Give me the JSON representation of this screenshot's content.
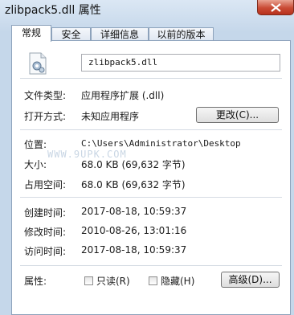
{
  "window": {
    "title": "zlibpack5.dll 属性"
  },
  "tabs": [
    {
      "label": "常规",
      "active": true
    },
    {
      "label": "安全",
      "active": false
    },
    {
      "label": "详细信息",
      "active": false
    },
    {
      "label": "以前的版本",
      "active": false
    }
  ],
  "general": {
    "file_name": "zlibpack5.dll",
    "type_label": "文件类型:",
    "type_value": "应用程序扩展 (.dll)",
    "opens_label": "打开方式:",
    "opens_value": "未知应用程序",
    "change_button": "更改(C)...",
    "location_label": "位置:",
    "location_value": "C:\\Users\\Administrator\\Desktop",
    "size_label": "大小:",
    "size_value": "68.0 KB (69,632 字节)",
    "disk_label": "占用空间:",
    "disk_value": "68.0 KB (69,632 字节)",
    "created_label": "创建时间:",
    "created_value": "2017-08-18, 10:59:37",
    "modified_label": "修改时间:",
    "modified_value": "2010-08-26, 13:01:16",
    "accessed_label": "访问时间:",
    "accessed_value": "2017-08-18, 10:59:37",
    "attributes_label": "属性:",
    "readonly_label": "只读(R)",
    "readonly_checked": false,
    "hidden_label": "隐藏(H)",
    "hidden_checked": false,
    "advanced_button": "高级(D)..."
  },
  "watermark": "WWW.9UPK.COM",
  "icons": {
    "file": "dll-file-icon",
    "close": "close-icon"
  },
  "colors": {
    "close_button": "#c94b35",
    "window_frame": "#c5d7ea"
  }
}
